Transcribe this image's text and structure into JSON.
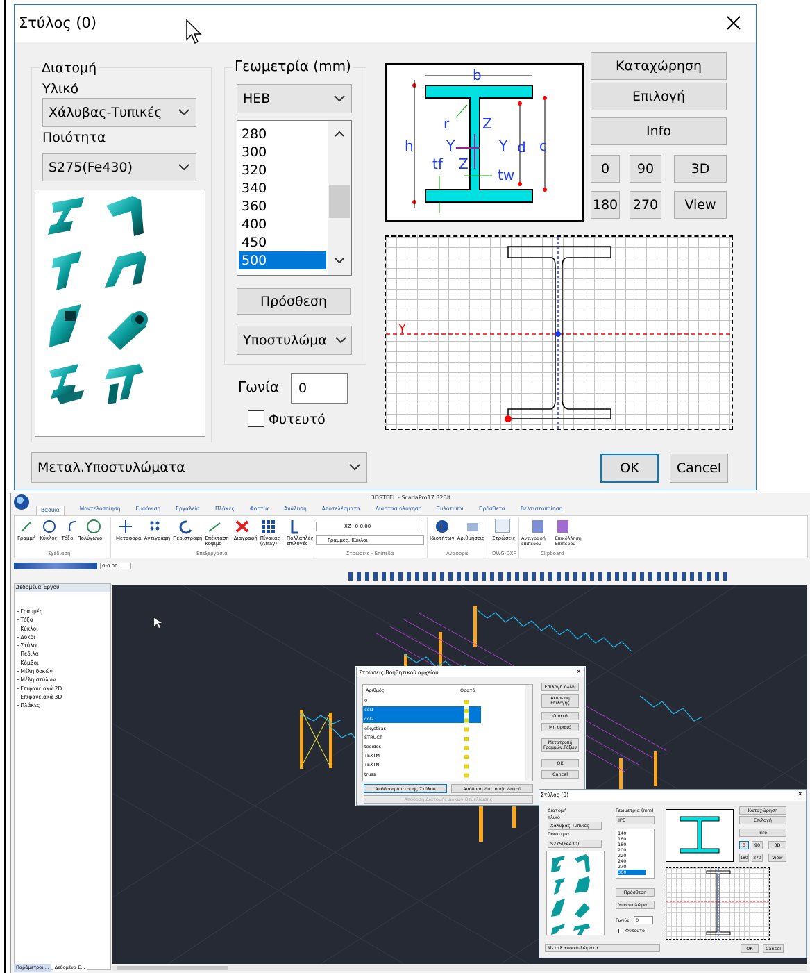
{
  "big_dialog": {
    "title": "Στύλος (0)",
    "group_section_label": "Διατομή",
    "material_label": "Υλικό",
    "material_value": "Χάλυβας-Τυπικές",
    "quality_label": "Ποιότητα",
    "quality_value": "S275(Fe430)",
    "geometry_label": "Γεωμετρία (mm)",
    "profile_value": "HEB",
    "sizes": [
      "280",
      "300",
      "320",
      "340",
      "360",
      "400",
      "450",
      "500"
    ],
    "selected_size": "500",
    "add_button": "Πρόσθεση",
    "element_type": "Υποστυλώμα",
    "angle_label": "Γωνία",
    "angle_value": "0",
    "planted_label": "Φυτευτό",
    "category_value": "Μεταλ.Υποστυλώματα",
    "register_button": "Καταχώρηση",
    "select_button": "Επιλογή",
    "info_button": "Info",
    "rot_0": "0",
    "rot_90": "90",
    "view_3d": "3D",
    "rot_180": "180",
    "rot_270": "270",
    "view_button": "View",
    "ok_button": "OK",
    "cancel_button": "Cancel",
    "diagram_labels": {
      "b": "b",
      "h": "h",
      "r": "r",
      "z": "Z",
      "y": "Y",
      "y2": "Y",
      "d": "d",
      "c": "c",
      "tf": "tf",
      "z2": "Z",
      "tw": "tw"
    },
    "axis_y": "Y"
  },
  "app": {
    "window_title": "3DSTEEL - ScadaPro17 32Bit",
    "tabs": [
      "Βασικά",
      "Μοντελοποίηση",
      "Εμφάνιση",
      "Εργαλεία",
      "Πλάκες",
      "Φορτία",
      "Ανάλυση",
      "Αποτελέσματα",
      "Διαστασιολόγηση",
      "Ξυλότυποι",
      "Πρόσθετα",
      "Βελτιστοποίηση"
    ],
    "ribbon_drawing": [
      "Γραμμή",
      "Κύκλος",
      "Τόξο",
      "Πολύγωνο"
    ],
    "ribbon_drawing_group": "Σχέδιαση",
    "ribbon_edit": [
      "Μεταφορά",
      "Αντιγραφή",
      "Περιστροφή",
      "Επέκταση κόψιμο",
      "Διαγραφή",
      "Πίνακας (Array)",
      "Πολλαπλές επιλογές"
    ],
    "ribbon_edit_group": "Επεξεργασία",
    "layer_axis": "XZ",
    "layer_elev": "0-0.00",
    "layer_name": "Γραμμές, Κύκλοι",
    "ribbon_layers_group": "Στρώσεις - Επίπεδα",
    "ribbon_ref": [
      "Ιδιοτήτων",
      "Αριθμήσεις"
    ],
    "ribbon_ref_group": "Αναφορά",
    "ribbon_dwg": [
      "Στρώσεις"
    ],
    "ribbon_dwg_group": "DWG-DXF",
    "ribbon_clip": [
      "Αντιγραφή επιπέδου",
      "Επικόλληση Επιπέδου"
    ],
    "ribbon_clip_group": "Clipboard",
    "qa_elev": "0-0.00",
    "panel_title": "Δεδομένα Έργου",
    "tree": [
      "Γραμμές",
      "Τόξα",
      "Κύκλοι",
      "Δοκοί",
      "Στύλοι",
      "Πέδιλα",
      "Κόμβοι",
      "Μέλη δοκών",
      "Μέλη στύλων",
      "Επιφανειακά 2D",
      "Επιφανειακά 3D",
      "Πλάκες"
    ],
    "bottom_tabs": [
      "Παράμετροι ...",
      "Δεδομένα Ε..."
    ],
    "layers_dialog": {
      "title": "Στρώσεις Βοηθητικού αρχείου",
      "col_number": "Αριθμός",
      "col_visible": "Ορατό",
      "rows": [
        "0",
        "col1",
        "col2",
        "elkystiras",
        "STRUCT",
        "tegides",
        "TEXTM",
        "TEXTN",
        "truss"
      ],
      "btn_select_all": "Επιλογή όλων",
      "btn_cancel_sel": "Ακύρωση Επιλογής",
      "btn_visible": "Ορατό",
      "btn_not_visible": "Μη ορατό",
      "btn_convert": "Μετατροπή Γραμμών,Τόξων",
      "btn_ok": "OK",
      "btn_cancel": "Cancel",
      "btn_assign_column": "Απόδοση Διατομής Στύλου",
      "btn_assign_beam": "Απόδοση Διατομής Δοκού",
      "btn_assign_found": "Απόδοση Διατομής Δοκών Θεμελίωσης"
    },
    "small_dialog": {
      "title": "Στύλος (0)",
      "section": "Διατομή",
      "material_label": "Υλικό",
      "material_value": "Χάλυβας-Τυπικές",
      "quality_label": "Ποιότητα",
      "quality_value": "S275(Fe430)",
      "geometry_label": "Γεωμετρία (mm)",
      "profile_value": "IPE",
      "sizes": [
        "140",
        "160",
        "180",
        "200",
        "220",
        "240",
        "270",
        "300"
      ],
      "add_button": "Πρόσθεση",
      "element_type": "Υποστυλώμα",
      "angle_label": "Γωνία",
      "angle_value": "0",
      "planted_label": "Φυτευτό",
      "category_value": "Μεταλ.Υποστυλώματα",
      "register_button": "Καταχώρηση",
      "select_button": "Επιλογή",
      "info_button": "Info",
      "rot_0": "0",
      "rot_90": "90",
      "view_3d": "3D",
      "rot_180": "180",
      "rot_270": "270",
      "view_button": "View",
      "ok_button": "OK",
      "cancel_button": "Cancel"
    }
  },
  "colors": {
    "accent": "#1e7bd7",
    "select": "#0078d7",
    "viewport": "#262a35",
    "steel": "#00e0e0",
    "column": "#f5a623",
    "truss": "#21b6e8"
  }
}
